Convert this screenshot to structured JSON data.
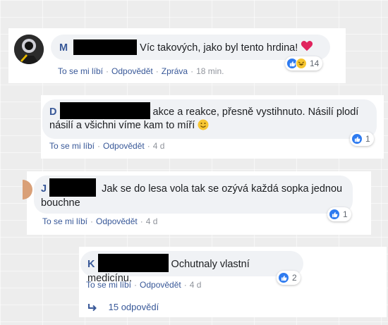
{
  "comments": [
    {
      "initial": "M",
      "text": "Víc takových, jako byl tento hrdina! ",
      "actions": {
        "like": "To se mi líbí",
        "reply": "Odpovědět",
        "message": "Zpráva",
        "time": "18 min."
      },
      "reaction_count": "14"
    },
    {
      "initial": "D",
      "text_line1": "akce a reakce, přesně vystihnuto. Násilí plodí",
      "text_line2": "násilí a všichni víme kam to míří ",
      "actions": {
        "like": "To se mi líbí",
        "reply": "Odpovědět",
        "time": "4 d"
      },
      "reaction_count": "1"
    },
    {
      "initial": "J",
      "text_line1": "Jak se do lesa vola tak se ozývá každá sopka jednou",
      "text_line2": "bouchne",
      "actions": {
        "like": "To se mi líbí",
        "reply": "Odpovědět",
        "time": "4 d"
      },
      "reaction_count": "1"
    },
    {
      "initial": "K",
      "text": "Ochutnaly vlastní medicínu.",
      "actions": {
        "like": "To se mi líbí",
        "reply": "Odpovědět",
        "time": "4 d"
      },
      "reaction_count": "2"
    }
  ],
  "replies_link": "15 odpovědí",
  "colors": {
    "link": "#385898",
    "like": "#2e7bf0",
    "heart": "#e0245e",
    "bubble": "#f0f2f5"
  }
}
